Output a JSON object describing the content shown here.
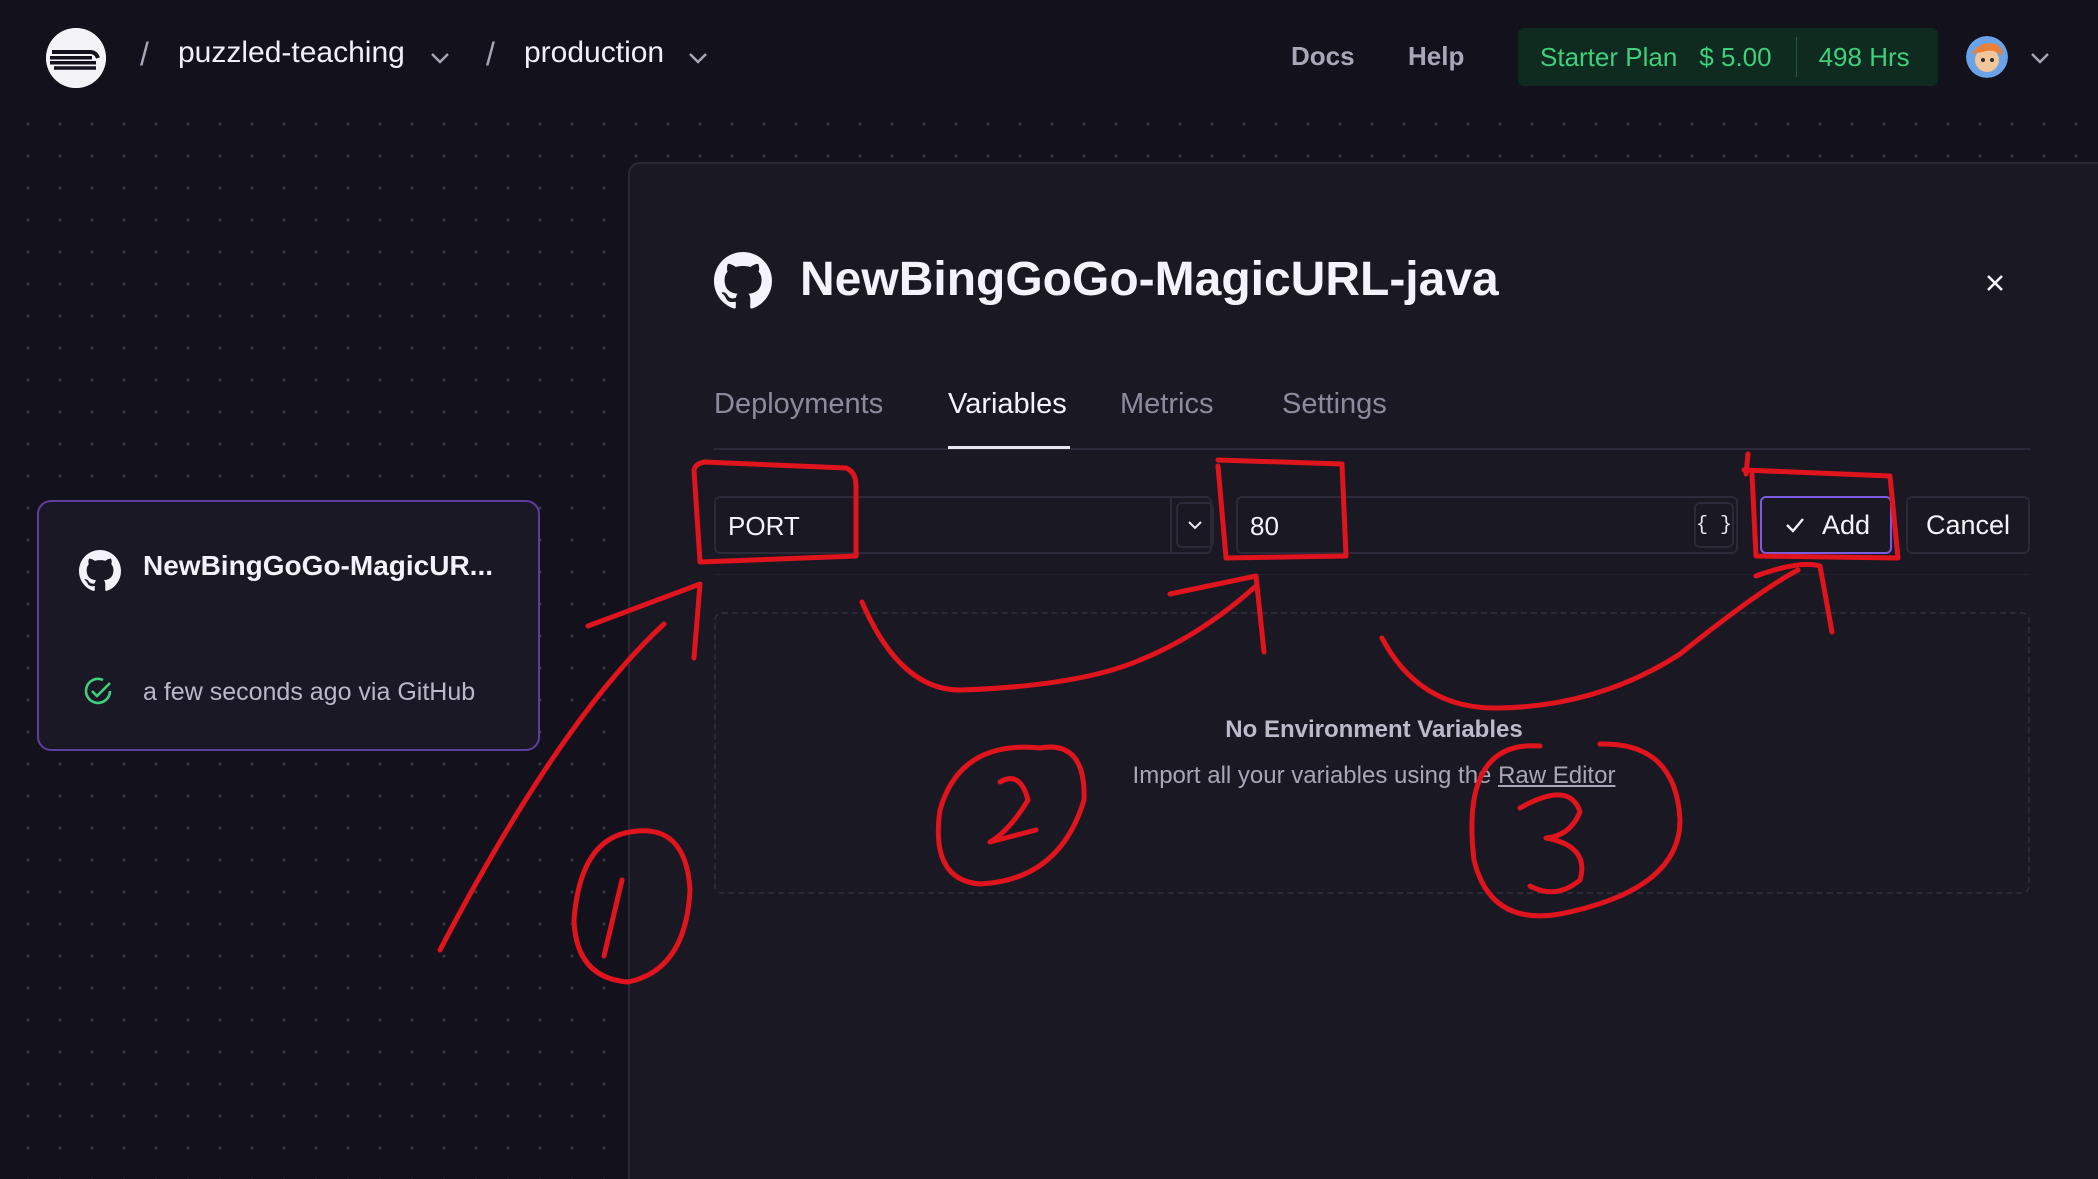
{
  "topbar": {
    "logo_icon": "railway-logo-icon",
    "breadcrumbs": [
      {
        "label": "puzzled-teaching"
      },
      {
        "label": "production"
      }
    ],
    "separator": "/",
    "links": {
      "docs": "Docs",
      "help": "Help"
    },
    "plan": {
      "name": "Starter Plan",
      "cost": "$ 5.00",
      "hours": "498 Hrs"
    },
    "avatar_icon": "user-avatar-icon"
  },
  "service_card": {
    "name": "NewBingGoGo-MagicUR...",
    "status": "a few seconds ago via GitHub",
    "status_color": "#3fcf7d"
  },
  "panel": {
    "title": "NewBingGoGo-MagicURL-java",
    "tabs": [
      {
        "label": "Deployments",
        "active": false
      },
      {
        "label": "Variables",
        "active": true
      },
      {
        "label": "Metrics",
        "active": false
      },
      {
        "label": "Settings",
        "active": false
      }
    ],
    "variable_form": {
      "name_value": "PORT",
      "value_value": "80",
      "json_button": "{ }",
      "add_label": "Add",
      "cancel_label": "Cancel"
    },
    "empty_state": {
      "title": "No Environment Variables",
      "subtitle_prefix": "Import all your variables using the ",
      "subtitle_link": "Raw Editor"
    }
  },
  "annotations": {
    "color": "#e0141c",
    "labels": [
      "1",
      "2",
      "3"
    ]
  },
  "colors": {
    "background": "#13111c",
    "accent": "#7b5ce0",
    "plan_green": "#3fcf7d"
  }
}
